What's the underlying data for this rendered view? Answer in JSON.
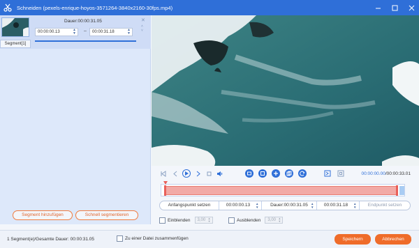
{
  "window": {
    "title": "Schneiden (pexels-enrique-hoyos-3571264-3840x2160-30fps.mp4)",
    "icons": {
      "app": "scissors-icon",
      "min": "minimize-icon",
      "max": "maximize-icon",
      "close": "close-icon"
    }
  },
  "segment": {
    "label": "Segment[1]",
    "duration": "Dauer:00:00:31.05",
    "start": "00:00:00.13",
    "end": "00:00:31.18",
    "dash": "–"
  },
  "left_buttons": {
    "add": "Segment hinzufügen",
    "fast": "Schnell segmentieren"
  },
  "controls": {
    "timecode_current": "00:00:00.00",
    "timecode_total": "/00:00:33.01",
    "icons": [
      "skip-start-icon",
      "prev-frame-icon",
      "play-icon",
      "next-frame-icon",
      "stop-icon",
      "volume-icon",
      "mark-in-icon",
      "mark-out-icon",
      "add-icon",
      "copy-icon",
      "reset-icon",
      "trim-start-icon",
      "trim-end-icon"
    ]
  },
  "trim": {
    "set_start": "Anfangspunkt setzen",
    "start": "00:00:00.13",
    "duration": "Dauer:00:00:31.05",
    "end": "00:00:31.18",
    "set_end": "Endpunkt setzen"
  },
  "fade": {
    "fade_in_label": "Einblenden",
    "fade_in_value": "3,00",
    "fade_out_label": "Ausblenden",
    "fade_out_value": "3,00"
  },
  "footer": {
    "summary": "1 Segment(e)/Gesamte Dauer: 00:00:31.05",
    "merge_label": "Zu einer Datei zusammenfügen",
    "save": "Speichern",
    "cancel": "Abbrechen"
  },
  "colors": {
    "accent": "#2f6fd8",
    "orange": "#ef6c2a",
    "segment_fill": "#f2aaa6"
  }
}
